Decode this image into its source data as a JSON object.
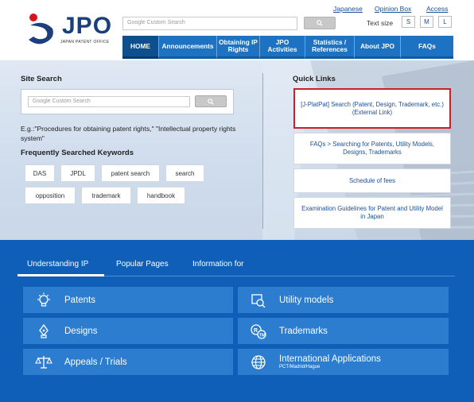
{
  "logo": {
    "text": "JPO",
    "subtitle": "JAPAN PATENT OFFICE"
  },
  "header": {
    "search_placeholder": "Google Custom Search",
    "links": [
      "Japanese",
      "Opinion Box",
      "Access"
    ],
    "text_size_label": "Text size",
    "text_sizes": [
      "S",
      "M",
      "L"
    ]
  },
  "nav": [
    {
      "label": "HOME",
      "active": true
    },
    {
      "label": "Announcements"
    },
    {
      "label": "Obtaining IP Rights"
    },
    {
      "label": "JPO Activities"
    },
    {
      "label": "Statistics / References"
    },
    {
      "label": "About JPO"
    },
    {
      "label": "FAQs"
    }
  ],
  "site_search": {
    "title": "Site Search",
    "placeholder": "Google Custom Search",
    "example": "E.g.:\"Procedures for obtaining patent rights,\" \"Intellectual property rights system\""
  },
  "keywords": {
    "title": "Frequently Searched Keywords",
    "items": [
      "DAS",
      "JPDL",
      "patent search",
      "search",
      "opposition",
      "trademark",
      "handbook"
    ]
  },
  "quick_links": {
    "title": "Quick Links",
    "items": [
      "[J-PlatPat] Search (Patent, Design, Trademark, etc.) (External Link)",
      "FAQs > Searching for Patents, Utility Models, Designs, Trademarks",
      "Schedule of fees",
      "Examination Guidelines for Patent and Utility Model in Japan"
    ]
  },
  "tabs": [
    "Understanding IP",
    "Popular Pages",
    "Information for"
  ],
  "categories": [
    {
      "label": "Patents",
      "icon": "lightbulb-icon"
    },
    {
      "label": "Utility models",
      "icon": "utility-model-icon"
    },
    {
      "label": "Designs",
      "icon": "pen-nib-icon"
    },
    {
      "label": "Trademarks",
      "icon": "trademark-icon"
    },
    {
      "label": "Appeals / Trials",
      "icon": "scales-icon"
    },
    {
      "label": "International Applications",
      "sub": "PCT/Madrid/Hague",
      "icon": "globe-icon"
    }
  ],
  "colors": {
    "nav_blue": "#1d72c2",
    "dark_blue": "#0f5fb8",
    "tile_blue": "#2c7dd0",
    "highlight_red": "#cc1f2c"
  }
}
